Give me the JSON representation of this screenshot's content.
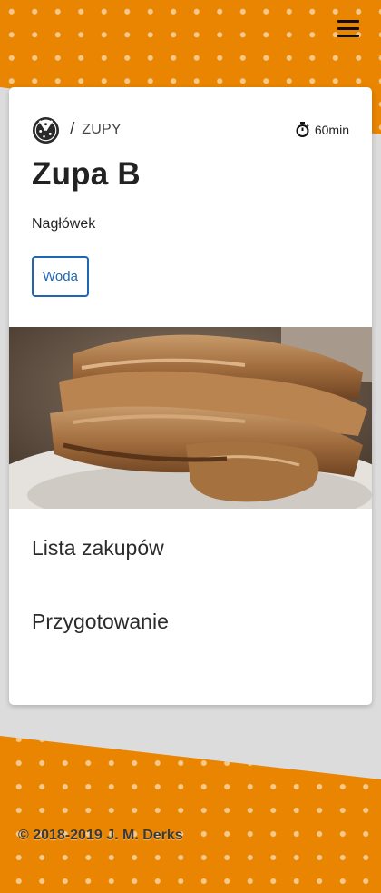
{
  "nav": {
    "menu_icon": "hamburger-menu-icon"
  },
  "recipe": {
    "category_icon": "pizza-logo-icon",
    "separator": "/",
    "category": "ZUPY",
    "time_icon": "stopwatch-icon",
    "time": "60min",
    "title": "Zupa B",
    "subheading": "Nagłówek",
    "tags": [
      "Woda"
    ],
    "image_alt": "fried breaded cutlets on a plate"
  },
  "sections": {
    "shopping_list": "Lista zakupów",
    "preparation": "Przygotowanie"
  },
  "footer": {
    "copyright": "© 2018-2019 J. M. Derks"
  },
  "colors": {
    "accent": "#e98500",
    "tag": "#1f66b4"
  }
}
